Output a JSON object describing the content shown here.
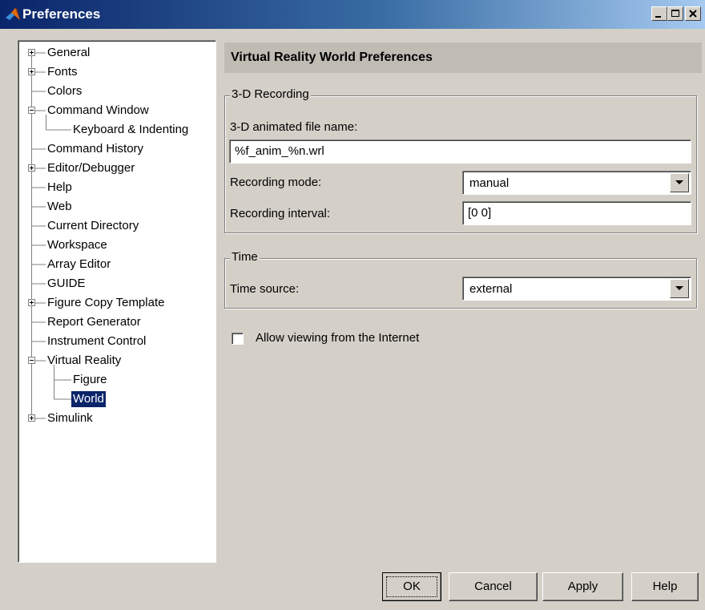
{
  "window": {
    "title": "Preferences"
  },
  "titlebar_buttons": {
    "minimize": "minimize-icon",
    "maximize": "maximize-icon",
    "close": "close-icon"
  },
  "tree": {
    "items": [
      {
        "label": "General",
        "expander": "plus"
      },
      {
        "label": "Fonts",
        "expander": "plus"
      },
      {
        "label": "Colors"
      },
      {
        "label": "Command Window",
        "expander": "minus"
      },
      {
        "label": "Keyboard & Indenting"
      },
      {
        "label": "Command History"
      },
      {
        "label": "Editor/Debugger",
        "expander": "plus"
      },
      {
        "label": "Help"
      },
      {
        "label": "Web"
      },
      {
        "label": "Current Directory"
      },
      {
        "label": "Workspace"
      },
      {
        "label": "Array Editor"
      },
      {
        "label": "GUIDE"
      },
      {
        "label": "Figure Copy Template",
        "expander": "plus"
      },
      {
        "label": "Report Generator"
      },
      {
        "label": "Instrument Control"
      },
      {
        "label": "Virtual Reality",
        "expander": "minus"
      },
      {
        "label": "Figure"
      },
      {
        "label": "World",
        "selected": true
      },
      {
        "label": "Simulink",
        "expander": "plus"
      }
    ]
  },
  "panel": {
    "title": "Virtual Reality World Preferences"
  },
  "recording": {
    "legend": "3-D Recording",
    "file_label": "3-D animated file name:",
    "file_value": "%f_anim_%n.wrl",
    "mode_label": "Recording mode:",
    "mode_value": "manual",
    "interval_label": "Recording interval:",
    "interval_value": "[0 0]"
  },
  "time": {
    "legend": "Time",
    "source_label": "Time source:",
    "source_value": "external"
  },
  "internet": {
    "label": "Allow viewing from the Internet",
    "checked": false
  },
  "buttons": {
    "ok": "OK",
    "cancel": "Cancel",
    "apply": "Apply",
    "help": "Help"
  },
  "colors": {
    "title_start": "#0a246a",
    "title_end": "#a6caf0",
    "selection": "#0a246a",
    "face": "#d4d0c8"
  }
}
